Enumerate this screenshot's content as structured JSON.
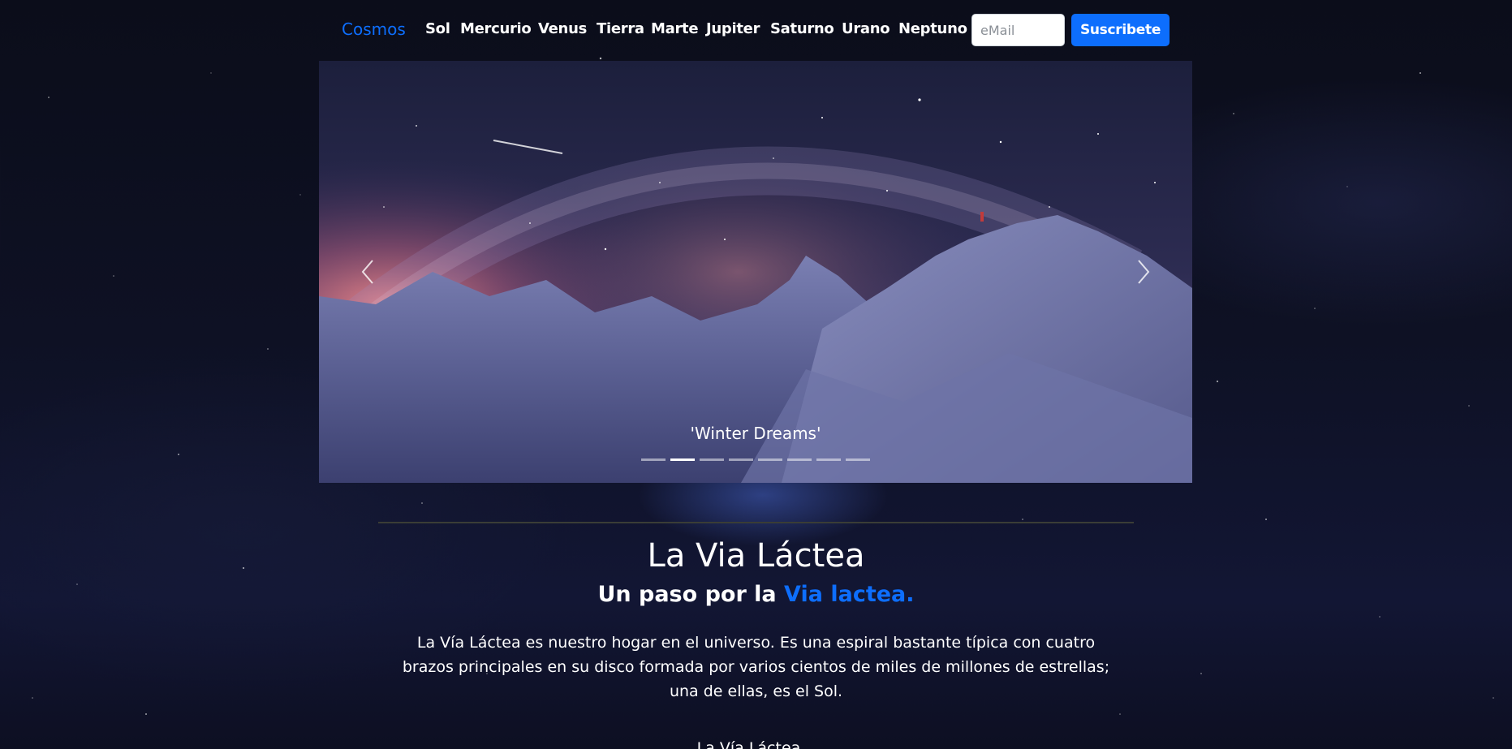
{
  "navbar": {
    "brand": "Cosmos",
    "links": [
      {
        "label": "Sol"
      },
      {
        "label": "Mercurio"
      },
      {
        "label": "Venus"
      },
      {
        "label": "Tierra"
      },
      {
        "label": "Marte"
      },
      {
        "label": "Jupiter"
      },
      {
        "label": "Saturno"
      },
      {
        "label": "Urano"
      },
      {
        "label": "Neptuno"
      }
    ],
    "email_placeholder": "eMail",
    "subscribe_label": "Suscribete"
  },
  "carousel": {
    "caption": "'Winter Dreams'",
    "slide_count": 8,
    "active_index": 1,
    "prev_icon": "chevron-left-icon",
    "next_icon": "chevron-right-icon"
  },
  "section": {
    "title": "La Via Láctea",
    "subtitle_prefix": "Un paso por la ",
    "subtitle_highlight": "Via lactea.",
    "paragraph": "La Vía Láctea es nuestro hogar en el universo. Es una espiral bastante típica con cuatro brazos principales en su disco formada por varios cientos de miles de millones de estrellas; una de ellas, es el Sol.",
    "paragraph2": "La Vía Láctea es ella...",
    "paragraph2_partial": "La Vía Láctea..."
  },
  "colors": {
    "accent": "#0d6efd",
    "background": "#0e1124"
  }
}
